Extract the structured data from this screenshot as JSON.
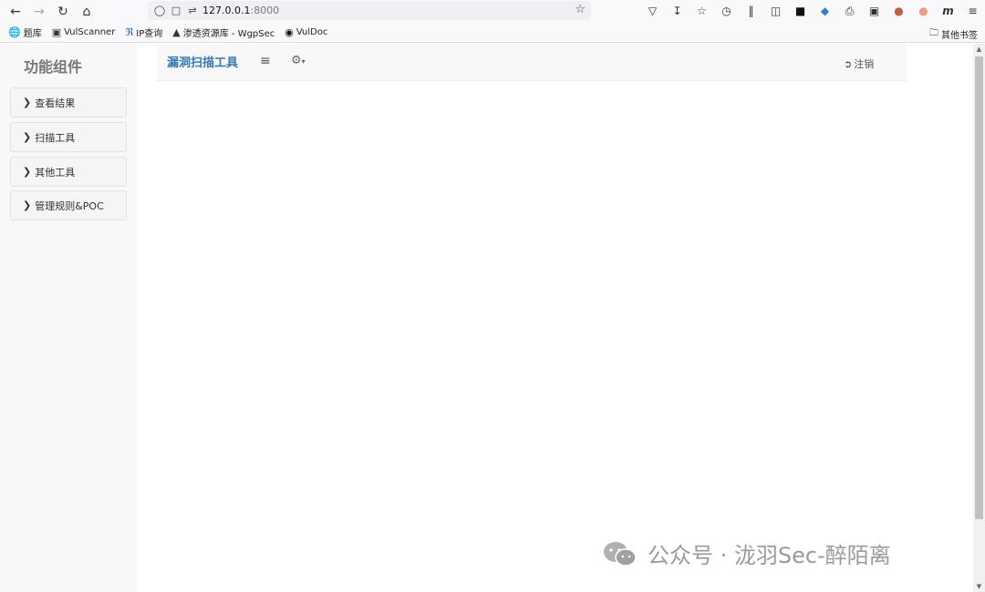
{
  "browser": {
    "url_host": "127.0.0.1",
    "url_port": ":8000",
    "bookmarks": [
      {
        "label": "题库",
        "icon": "globe-icon"
      },
      {
        "label": "VulScanner",
        "icon": "image-icon"
      },
      {
        "label": "IP查询",
        "icon": "ip-icon"
      },
      {
        "label": "渗透资源库 - WgpSec",
        "icon": "wolf-icon"
      },
      {
        "label": "VulDoc",
        "icon": "circle-logo-icon"
      }
    ],
    "other_bookmarks": "其他书签"
  },
  "sidebar": {
    "title": "功能组件",
    "items": [
      {
        "label": "查看结果"
      },
      {
        "label": "扫描工具"
      },
      {
        "label": "其他工具"
      },
      {
        "label": "管理规则&POC"
      }
    ]
  },
  "navbar": {
    "brand": "漏洞扫描工具",
    "logout": "注销"
  },
  "watermark": {
    "text": "公众号 · 泷羽Sec-醉陌离"
  },
  "colors": {
    "brand": "#337ab7",
    "sidebar_bg": "#f8f8f8"
  }
}
